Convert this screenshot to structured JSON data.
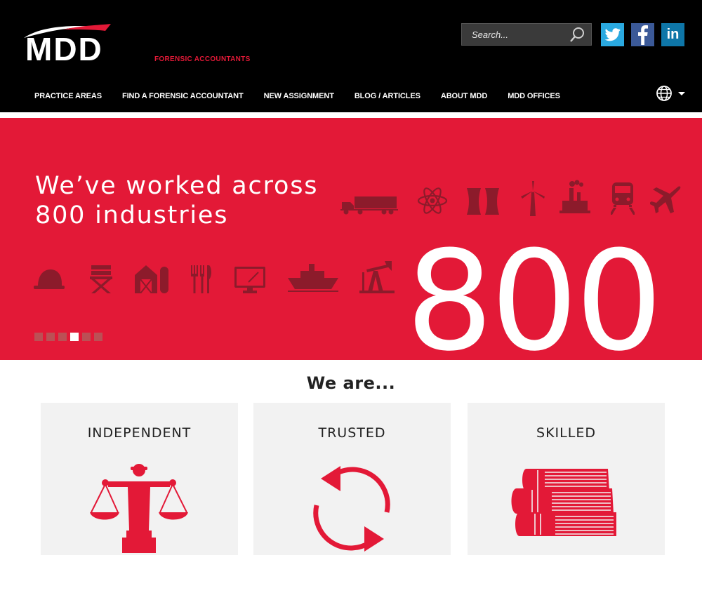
{
  "brand": {
    "logo_text": "MDD",
    "tagline": "FORENSIC ACCOUNTANTS",
    "accent_color": "#e31937"
  },
  "search": {
    "placeholder": "Search...",
    "icon": "search-icon"
  },
  "social": [
    {
      "name": "twitter",
      "icon": "twitter-icon",
      "color": "#2aa9e0"
    },
    {
      "name": "facebook",
      "icon": "facebook-icon",
      "color": "#3b5998"
    },
    {
      "name": "linkedin",
      "icon": "linkedin-icon",
      "label": "in",
      "color": "#0e76a8"
    }
  ],
  "nav": {
    "items": [
      {
        "label": "PRACTICE AREAS"
      },
      {
        "label": "FIND A FORENSIC ACCOUNTANT"
      },
      {
        "label": "NEW ASSIGNMENT"
      },
      {
        "label": "BLOG / ARTICLES"
      },
      {
        "label": "ABOUT MDD"
      },
      {
        "label": "MDD OFFICES"
      }
    ],
    "language_icon": "globe-icon"
  },
  "hero": {
    "headline_line1": "We’ve worked across",
    "headline_line2": "800 industries",
    "big_number": "800",
    "industry_icons_row1": [
      "truck-icon",
      "atom-icon",
      "power-plant-icon",
      "wind-turbine-icon",
      "factory-icon",
      "train-icon",
      "airplane-icon"
    ],
    "industry_icons_row2": [
      "hard-hat-icon",
      "directors-chair-icon",
      "barn-icon",
      "cutlery-icon",
      "monitor-icon",
      "ship-icon",
      "oil-pump-icon"
    ],
    "slides_total": 6,
    "active_slide": 4
  },
  "values": {
    "heading": "We are...",
    "cards": [
      {
        "title": "INDEPENDENT",
        "icon": "scales-icon"
      },
      {
        "title": "TRUSTED",
        "icon": "cycle-arrows-icon"
      },
      {
        "title": "SKILLED",
        "icon": "books-icon"
      }
    ]
  }
}
